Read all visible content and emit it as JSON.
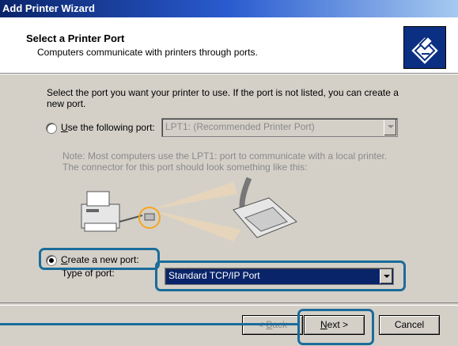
{
  "window": {
    "title": "Add Printer Wizard"
  },
  "header": {
    "title": "Select a Printer Port",
    "subtitle": "Computers communicate with printers through ports."
  },
  "intro": "Select the port you want your printer to use.  If the port is not listed, you can create a new port.",
  "option_existing": {
    "label_underlined": "U",
    "label_rest": "se the following port:",
    "selected": false,
    "port_value": "LPT1: (Recommended Printer Port)",
    "note": "Note: Most computers use the LPT1: port to communicate with a local printer. The connector for this port should look something like this:"
  },
  "option_new": {
    "label_underlined": "C",
    "label_rest": "reate a new port:",
    "selected": true,
    "type_label": "Type of port:",
    "type_value": "Standard TCP/IP Port"
  },
  "buttons": {
    "back_underlined": "B",
    "back_prefix": "< ",
    "back_rest": "ack",
    "next_underlined": "N",
    "next_rest": "ext >",
    "cancel": "Cancel"
  },
  "colors": {
    "highlight": "#1b6c9a",
    "selection": "#0a246a"
  }
}
